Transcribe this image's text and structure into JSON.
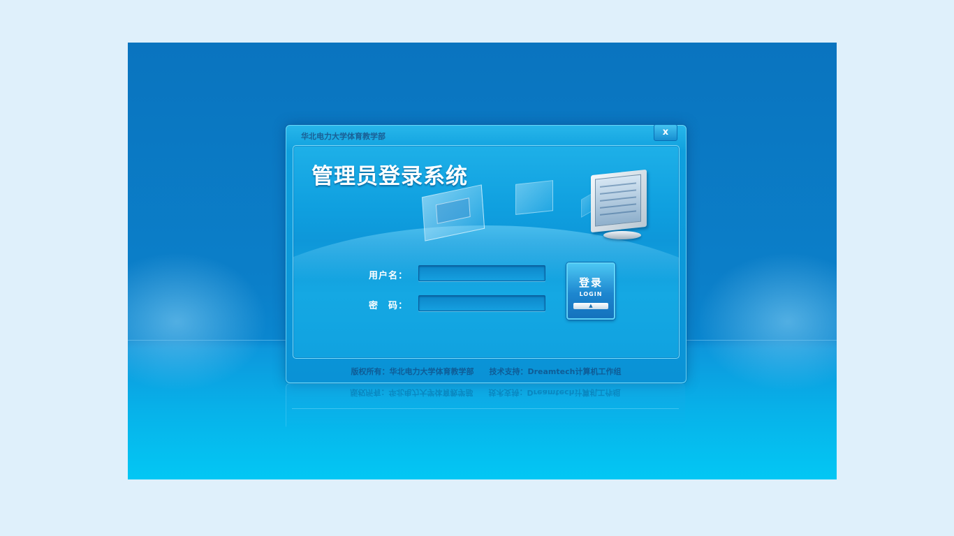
{
  "window": {
    "title": "华北电力大学体育教学部",
    "close_label": "x"
  },
  "login": {
    "system_title": "管理员登录系统",
    "username_label": "用户名：",
    "password_label": "密　码：",
    "username_value": "",
    "password_value": "",
    "button_label": "登录",
    "button_sublabel": "LOGIN",
    "button_arrow": "▲"
  },
  "footer": {
    "text": "版权所有：华北电力大学体育教学部　　技术支持：Dreamtech计算机工作组"
  },
  "colors": {
    "page_background": "#dff0fb",
    "stage_blue": "#0a74bf",
    "accent_cyan": "#03c7f4"
  }
}
